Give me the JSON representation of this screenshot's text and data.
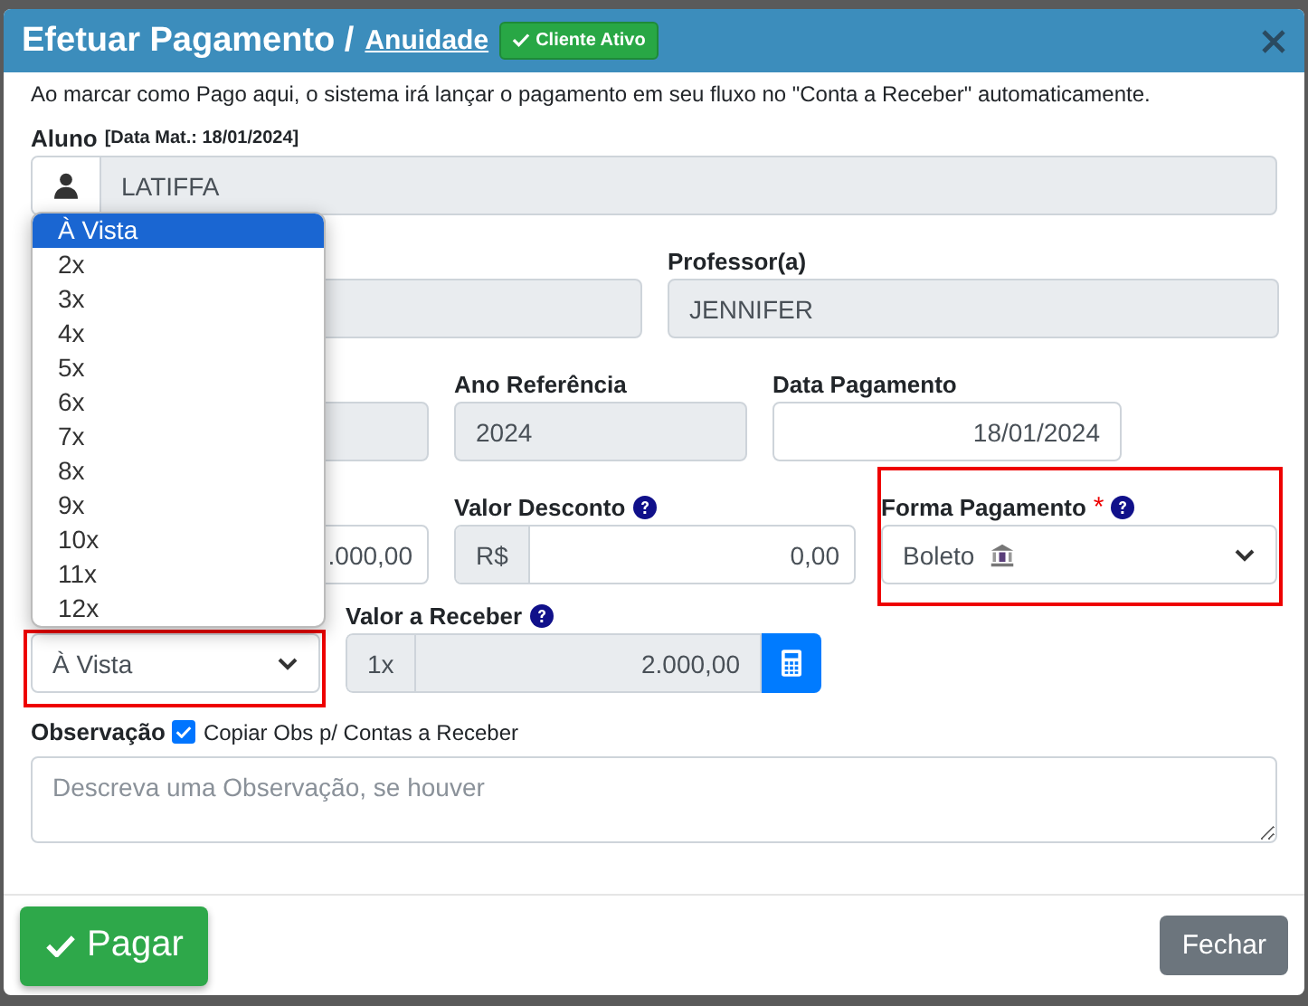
{
  "dialog": {
    "title": "Efetuar Pagamento /",
    "link": "Anuidade",
    "badge": "Cliente Ativo"
  },
  "notice": "Ao marcar como Pago aqui, o sistema irá lançar o pagamento em seu fluxo no \"Conta a Receber\" automaticamente.",
  "student": {
    "label": "Aluno",
    "note": "[Data Mat.: 18/01/2024]",
    "value": "LATIFFA"
  },
  "rows": [
    [
      {
        "kind": "text",
        "disabled": true,
        "highlighted": false
      },
      {
        "kind": "text",
        "label": "Professor(a)",
        "value": "JENNIFER",
        "disabled": true,
        "highlighted": false
      }
    ],
    [
      {
        "kind": "text",
        "disabled": true,
        "highlighted": false
      },
      {
        "kind": "text",
        "label": "Ano Referência",
        "value": "2024",
        "disabled": true,
        "highlighted": false
      },
      {
        "kind": "date",
        "label": "Data Pagamento",
        "value": "18/01/2024",
        "disabled": false,
        "highlighted": false
      }
    ],
    [
      {
        "kind": "amount",
        "value": ".000,00",
        "disabled": false,
        "highlighted": false
      },
      {
        "kind": "amount",
        "label": "Valor Desconto",
        "help": true,
        "prefix": "R$",
        "value": "0,00",
        "disabled": false,
        "highlighted": false
      },
      {
        "kind": "payment-select",
        "label": "Forma Pagamento",
        "required_mark": "*",
        "help": true,
        "value": "Boleto",
        "disabled": false,
        "highlighted": true
      }
    ],
    [
      {
        "kind": "select",
        "value": "À Vista",
        "disabled": false,
        "highlighted": true,
        "options": [
          {
            "label": "À Vista",
            "selected": true
          },
          {
            "label": "2x",
            "selected": false
          },
          {
            "label": "3x",
            "selected": false
          },
          {
            "label": "4x",
            "selected": false
          },
          {
            "label": "5x",
            "selected": false
          },
          {
            "label": "6x",
            "selected": false
          },
          {
            "label": "7x",
            "selected": false
          },
          {
            "label": "8x",
            "selected": false
          },
          {
            "label": "9x",
            "selected": false
          },
          {
            "label": "10x",
            "selected": false
          },
          {
            "label": "11x",
            "selected": false
          },
          {
            "label": "12x",
            "selected": false
          }
        ]
      },
      {
        "kind": "amount-calc",
        "label": "Valor a Receber",
        "help": true,
        "prefix": "1x",
        "value": "2.000,00",
        "disabled": true,
        "highlighted": false
      }
    ]
  ],
  "observation": {
    "label": "Observação",
    "copy_label": "Copiar Obs p/ Contas a Receber",
    "copy_checked": true,
    "placeholder": "Descreva uma Observação, se houver"
  },
  "footer": {
    "pay": "Pagar",
    "close": "Fechar"
  }
}
